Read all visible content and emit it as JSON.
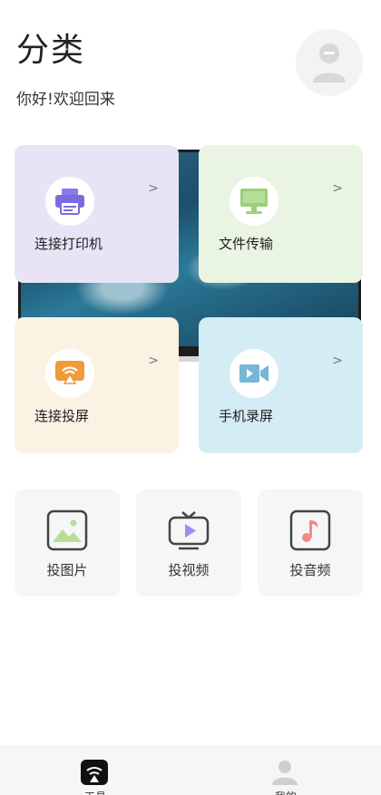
{
  "header": {
    "title": "分类",
    "subtitle": "你好!欢迎回来"
  },
  "cards": [
    {
      "label": "连接打印机",
      "icon": "printer-icon",
      "bg": "#e8e4f6",
      "accent": "#7b6be0"
    },
    {
      "label": "文件传输",
      "icon": "monitor-icon",
      "bg": "#eaf4e2",
      "accent": "#9ccf7a"
    },
    {
      "label": "连接投屏",
      "icon": "screencast-icon",
      "bg": "#fcf2e4",
      "accent": "#f09a3a"
    },
    {
      "label": "手机录屏",
      "icon": "video-camera-icon",
      "bg": "#d4ecf4",
      "accent": "#76b6d6"
    }
  ],
  "chevron": ">",
  "tiles": [
    {
      "label": "投图片",
      "icon": "image-icon"
    },
    {
      "label": "投视频",
      "icon": "tv-play-icon"
    },
    {
      "label": "投音频",
      "icon": "music-note-icon"
    }
  ],
  "tabs": [
    {
      "label": "工具",
      "icon": "tools-tab-icon",
      "active": true
    },
    {
      "label": "我的",
      "icon": "profile-tab-icon",
      "active": false
    }
  ]
}
